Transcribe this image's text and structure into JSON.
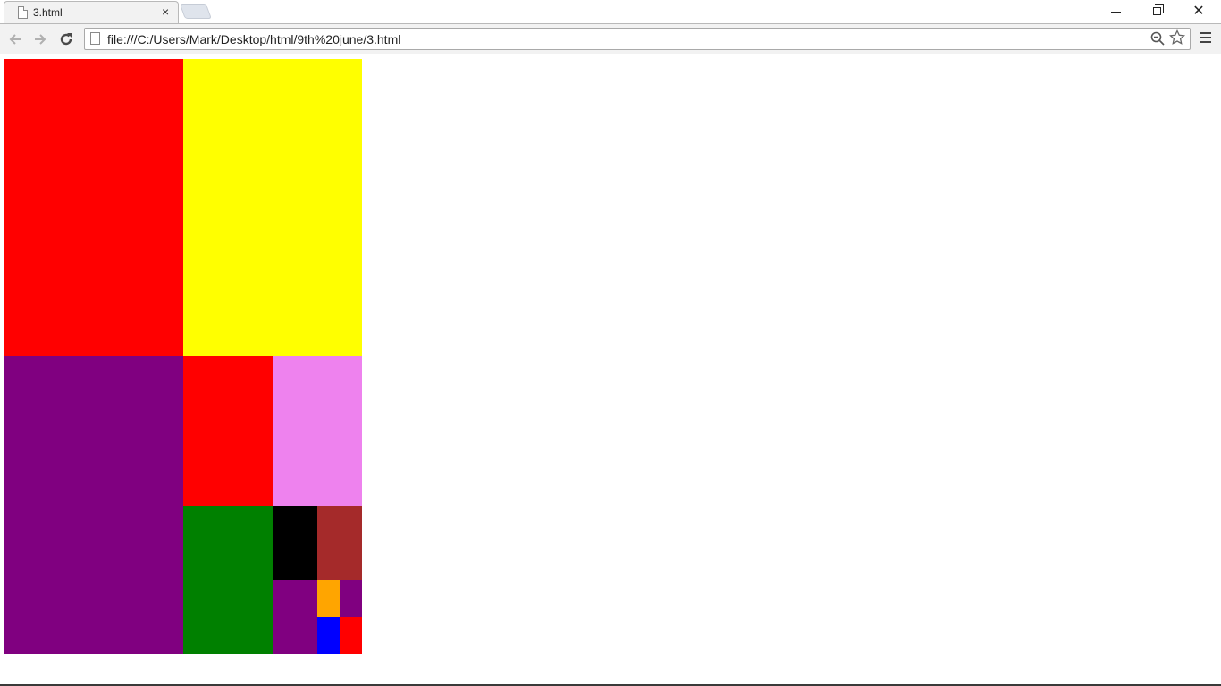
{
  "browser": {
    "tab_title": "3.html",
    "tab_close": "×",
    "url": "file:///C:/Users/Mark/Desktop/html/9th%20june/3.html",
    "window_close_glyph": "✕"
  },
  "page": {
    "blocks": [
      {
        "id": "red-big",
        "color": "#ff0000"
      },
      {
        "id": "yellow",
        "color": "#ffff00"
      },
      {
        "id": "purple-big",
        "color": "#800080"
      },
      {
        "id": "red-mid",
        "color": "#ff0000"
      },
      {
        "id": "violet",
        "color": "#ee82ee"
      },
      {
        "id": "green",
        "color": "#008000"
      },
      {
        "id": "black",
        "color": "#000000"
      },
      {
        "id": "brown",
        "color": "#a52a2a"
      },
      {
        "id": "purple-sm",
        "color": "#800080"
      },
      {
        "id": "orange",
        "color": "#ffa500"
      },
      {
        "id": "purple-xs",
        "color": "#800080"
      },
      {
        "id": "blue",
        "color": "#0000ff"
      },
      {
        "id": "red-xs",
        "color": "#ff0000"
      }
    ]
  }
}
